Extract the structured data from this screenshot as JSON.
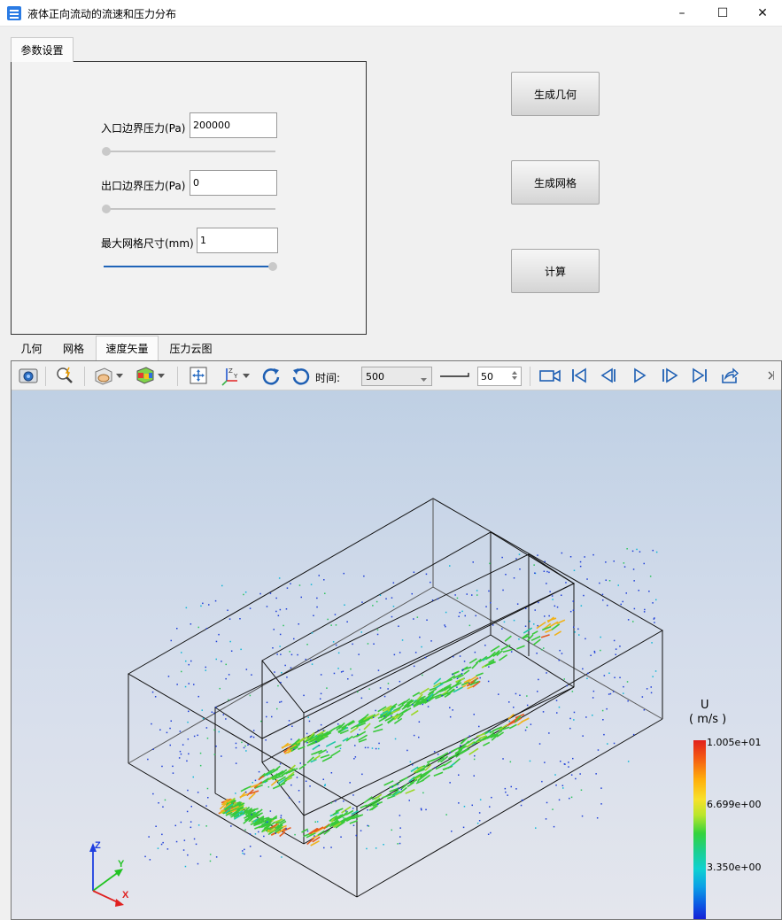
{
  "window": {
    "title": "液体正向流动的流速和压力分布",
    "min_glyph": "–",
    "max_glyph": "☐",
    "close_glyph": "✕"
  },
  "params_tab": {
    "label": "参数设置"
  },
  "params": {
    "inlet": {
      "label": "入口边界压力(Pa)",
      "value": "200000",
      "slider_level": 0.0
    },
    "outlet": {
      "label": "出口边界压力(Pa)",
      "value": "0",
      "slider_level": 0.0
    },
    "mesh": {
      "label": "最大网格尺寸(mm)",
      "value": "1",
      "slider_level": 1.0
    }
  },
  "buttons": {
    "geometry": "生成几何",
    "mesh": "生成网格",
    "compute": "计算"
  },
  "view_tabs": [
    "几何",
    "网格",
    "速度矢量",
    "压力云图"
  ],
  "active_view_tab": 2,
  "toolbar": {
    "time_label": "时间:",
    "time_value": "500",
    "step_value": "50"
  },
  "legend": {
    "title_u": "U",
    "title_unit": "( m/s )",
    "max": "1.005e+01",
    "mid": "6.699e+00",
    "low": "3.350e+00"
  },
  "axes": {
    "x": "X",
    "y": "Y",
    "z": "Z"
  },
  "colors": {
    "accent": "#1f64b8",
    "x_axis": "#e02020",
    "y_axis": "#22c322",
    "z_axis": "#1f3fe0"
  }
}
